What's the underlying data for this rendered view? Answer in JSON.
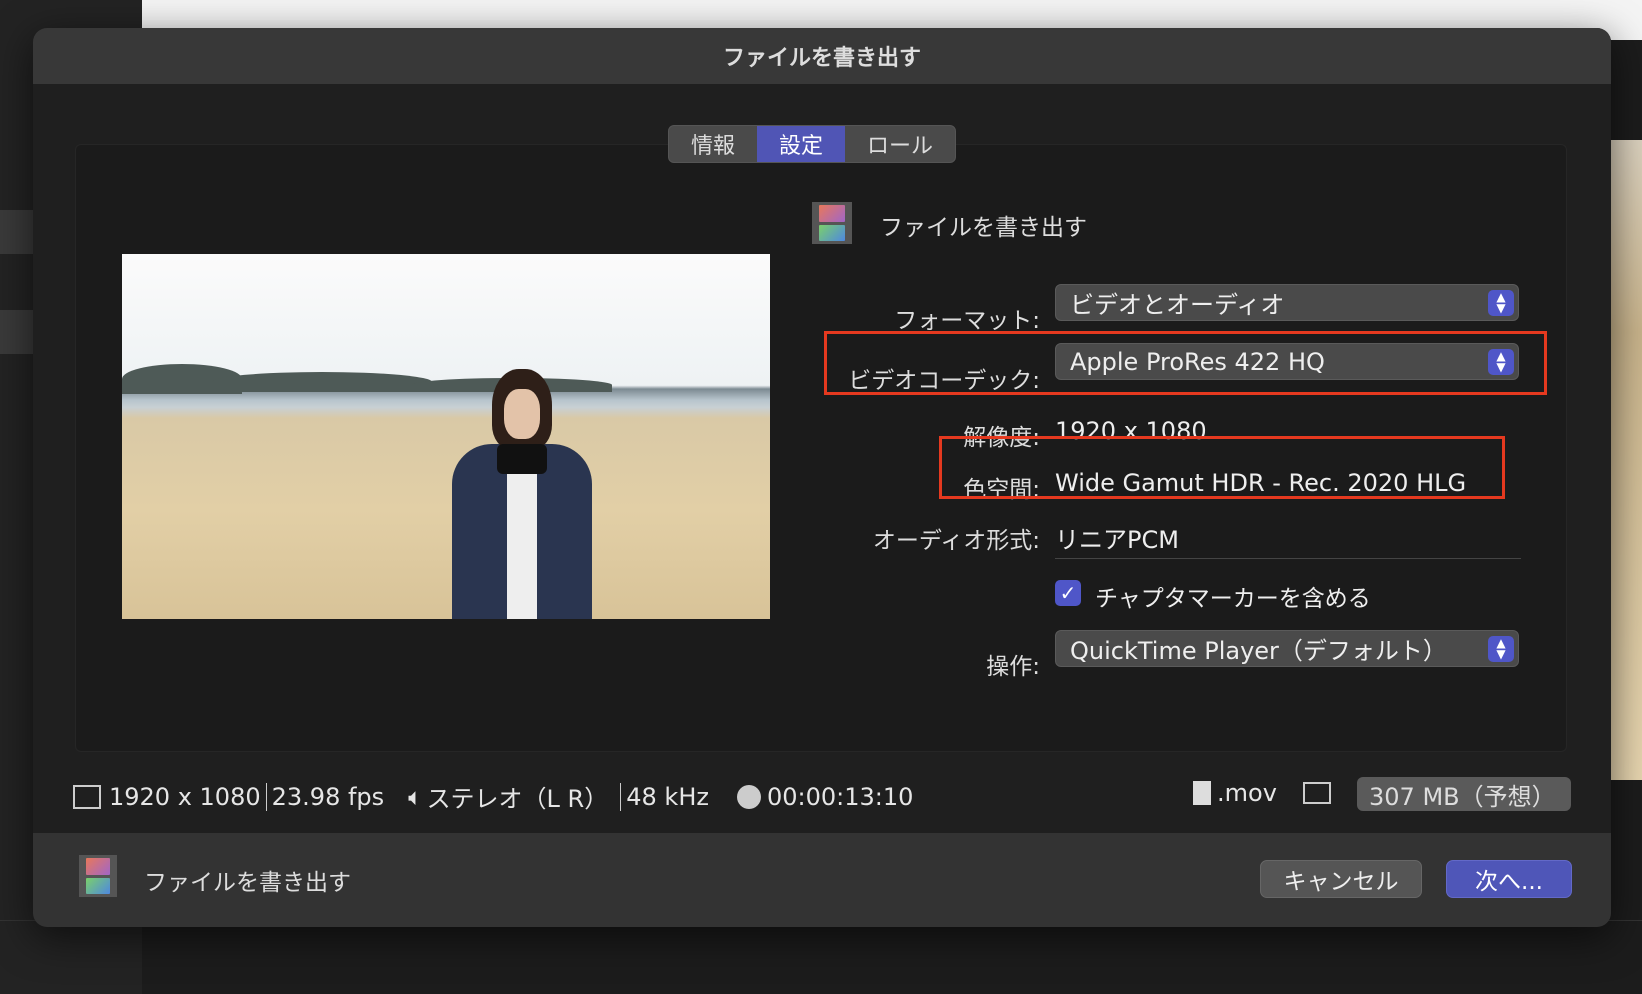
{
  "dialog": {
    "title": "ファイルを書き出す"
  },
  "tabs": [
    {
      "label": "情報"
    },
    {
      "label": "設定",
      "active": true
    },
    {
      "label": "ロール"
    }
  ],
  "header": {
    "title": "ファイルを書き出す",
    "icon": "film-icon"
  },
  "settings": {
    "format": {
      "label": "フォーマット:",
      "value": "ビデオとオーディオ"
    },
    "codec": {
      "label": "ビデオコーデック:",
      "value": "Apple ProRes 422 HQ"
    },
    "resolution": {
      "label": "解像度:",
      "value": "1920 x 1080"
    },
    "colorspace": {
      "label": "色空間:",
      "value": "Wide Gamut HDR - Rec. 2020 HLG"
    },
    "audio": {
      "label": "オーディオ形式:",
      "value": "リニアPCM"
    },
    "chapter": {
      "label": "チャプタマーカーを含める",
      "checked": true
    },
    "action": {
      "label": "操作:",
      "value": "QuickTime Player（デフォルト）"
    }
  },
  "status": {
    "resolution": "1920 x 1080",
    "fps": "23.98 fps",
    "channels": "ステレオ（L R）",
    "rate": "48 kHz",
    "duration": "00:00:13:10",
    "ext": ".mov",
    "size": "307 MB（予想）"
  },
  "footer": {
    "title": "ファイルを書き出す",
    "cancel": "キャンセル",
    "next": "次へ..."
  },
  "colors": {
    "accent": "#5055b5",
    "highlight": "#e5391f"
  }
}
